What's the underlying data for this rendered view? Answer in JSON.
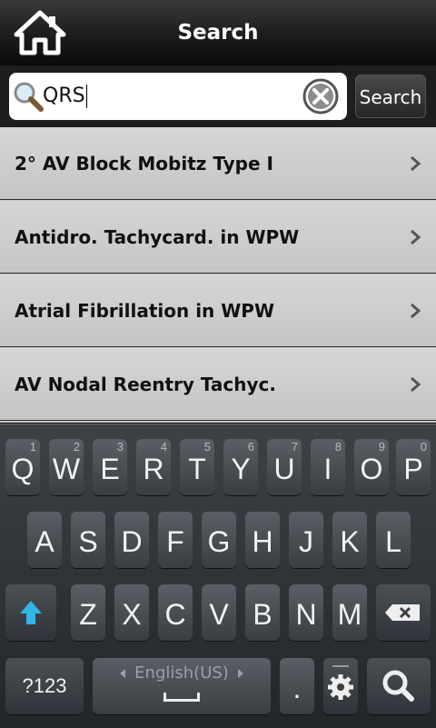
{
  "header": {
    "title": "Search",
    "home_icon": "home-icon"
  },
  "search": {
    "query": "QRS",
    "button_label": "Search",
    "search_icon": "magnifier-icon",
    "clear_icon": "clear-icon"
  },
  "results": [
    {
      "label": "2° AV Block Mobitz Type I"
    },
    {
      "label": "Antidro. Tachycard. in WPW"
    },
    {
      "label": "Atrial Fibrillation in WPW"
    },
    {
      "label": "AV Nodal Reentry Tachyc."
    }
  ],
  "keyboard": {
    "row1": [
      {
        "k": "Q",
        "n": "1"
      },
      {
        "k": "W",
        "n": "2"
      },
      {
        "k": "E",
        "n": "3"
      },
      {
        "k": "R",
        "n": "4"
      },
      {
        "k": "T",
        "n": "5"
      },
      {
        "k": "Y",
        "n": "6"
      },
      {
        "k": "U",
        "n": "7"
      },
      {
        "k": "I",
        "n": "8"
      },
      {
        "k": "O",
        "n": "9"
      },
      {
        "k": "P",
        "n": "0"
      }
    ],
    "row2": [
      "A",
      "S",
      "D",
      "F",
      "G",
      "H",
      "J",
      "K",
      "L"
    ],
    "row3": [
      "Z",
      "X",
      "C",
      "V",
      "B",
      "N",
      "M"
    ],
    "symbols_label": "?123",
    "language_label": "English(US)",
    "period_label": ".",
    "accent_color": "#33b5e5"
  }
}
